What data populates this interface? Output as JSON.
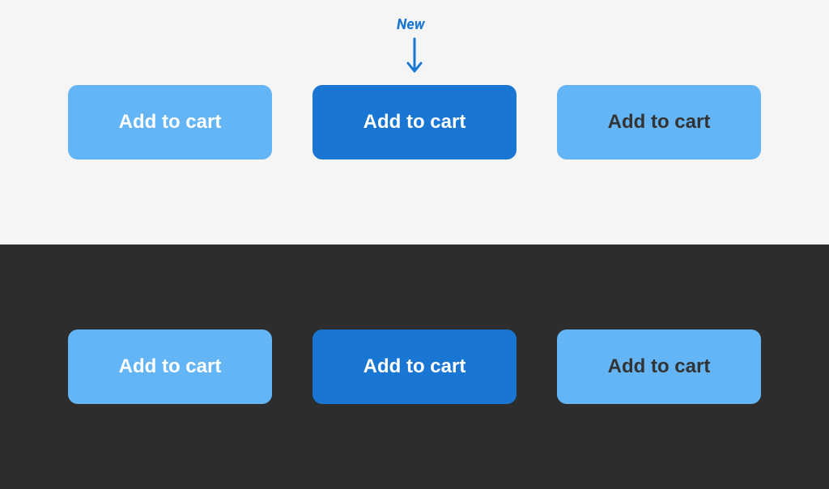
{
  "annotation": {
    "label": "New"
  },
  "light_panel": {
    "buttons": [
      {
        "label": "Add to cart",
        "variant": "light-white"
      },
      {
        "label": "Add to cart",
        "variant": "primary"
      },
      {
        "label": "Add to cart",
        "variant": "light-dark"
      }
    ]
  },
  "dark_panel": {
    "buttons": [
      {
        "label": "Add to cart",
        "variant": "light-white"
      },
      {
        "label": "Add to cart",
        "variant": "primary"
      },
      {
        "label": "Add to cart",
        "variant": "light-dark"
      }
    ]
  },
  "colors": {
    "light_button": "#64b5f6",
    "primary_button": "#1976d2",
    "panel_light": "#f5f5f5",
    "panel_dark": "#2d2d2d"
  }
}
